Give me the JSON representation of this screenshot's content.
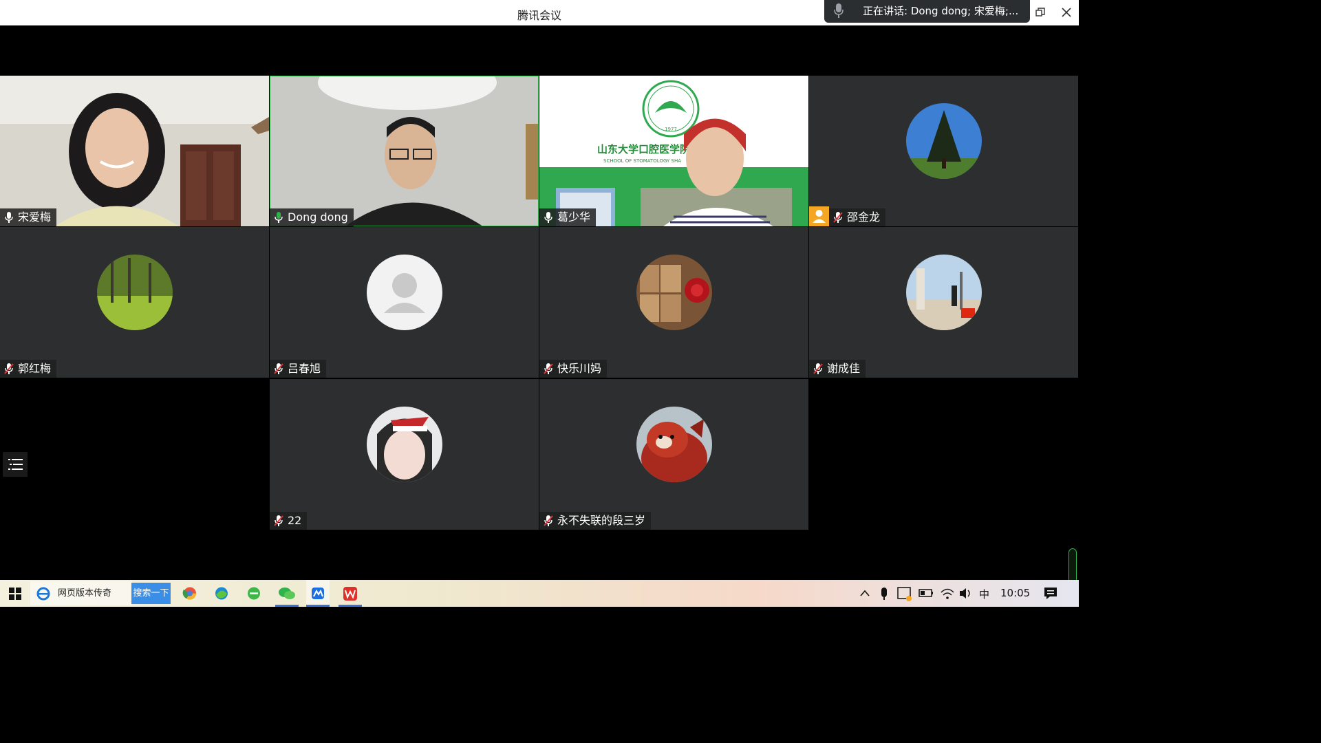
{
  "window": {
    "title": "腾讯会议",
    "speaking_text": "正在讲话: Dong dong; 宋爱梅;..."
  },
  "participants": [
    {
      "name": "宋爱梅",
      "mic": "on",
      "kind": "video"
    },
    {
      "name": "Dong dong",
      "mic": "on",
      "kind": "video",
      "active": true
    },
    {
      "name": "葛少华",
      "mic": "on",
      "kind": "video"
    },
    {
      "name": "邵金龙",
      "mic": "muted",
      "kind": "avatar"
    },
    {
      "name": "郭红梅",
      "mic": "muted",
      "kind": "avatar"
    },
    {
      "name": "吕春旭",
      "mic": "muted",
      "kind": "avatar-default"
    },
    {
      "name": "快乐川妈",
      "mic": "muted",
      "kind": "avatar"
    },
    {
      "name": "谢成佳",
      "mic": "muted",
      "kind": "avatar"
    },
    {
      "name": "22",
      "mic": "muted",
      "kind": "avatar"
    },
    {
      "name": "永不失联的段三岁",
      "mic": "muted",
      "kind": "avatar"
    }
  ],
  "slide": {
    "school_cn": "山东大学口腔医学院",
    "school_en": "SCHOOL OF STOMATOLOGY SHA",
    "logo_year": "1977"
  },
  "taskbar": {
    "browser_label": "网页版本传奇",
    "search_button": "搜索一下",
    "ime": "中",
    "time": "10:05"
  },
  "colors": {
    "accent_green": "#2fb34a",
    "muted_red": "#e0393e",
    "tile_bg": "#2c2e30"
  }
}
